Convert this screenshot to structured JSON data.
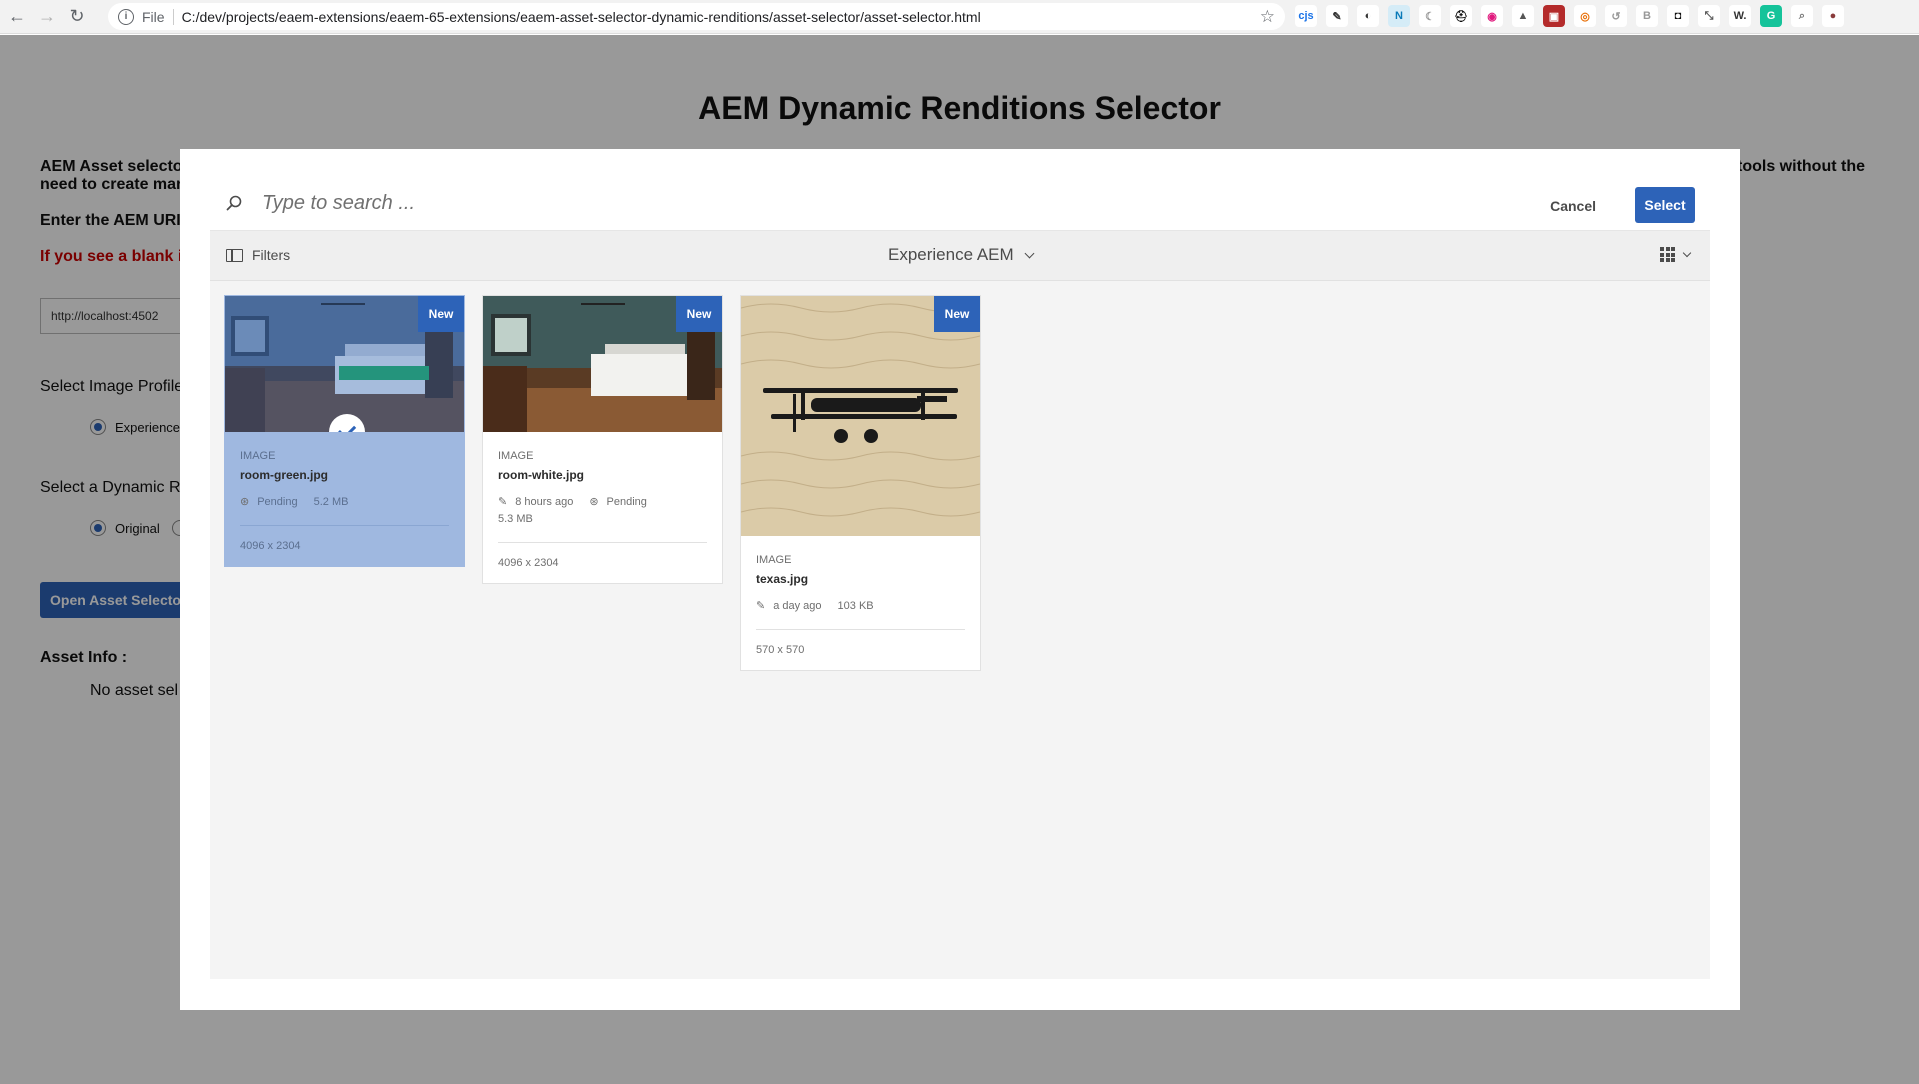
{
  "browser": {
    "url_scheme": "File",
    "url": "C:/dev/projects/eaem-extensions/eaem-65-extensions/eaem-asset-selector-dynamic-renditions/asset-selector/asset-selector.html",
    "extensions": [
      {
        "name": "cjs",
        "label": "cjs",
        "color": "#ffffff",
        "text": "#1a73e8"
      },
      {
        "name": "pen",
        "label": "✎",
        "color": "#ffffff",
        "text": "#333333"
      },
      {
        "name": "dark-reader",
        "label": "◐",
        "color": "#ffffff",
        "text": "#333333"
      },
      {
        "name": "n",
        "label": "N",
        "color": "#d5ecf7",
        "text": "#0a7ab8"
      },
      {
        "name": "moon",
        "label": "☾",
        "color": "#ffffff",
        "text": "#999999"
      },
      {
        "name": "spy",
        "label": "⛑",
        "color": "#ffffff",
        "text": "#111111"
      },
      {
        "name": "circle-pink",
        "label": "◉",
        "color": "#ffffff",
        "text": "#e0197d"
      },
      {
        "name": "drive",
        "label": "▲",
        "color": "#ffffff",
        "text": "#555555"
      },
      {
        "name": "red-box",
        "label": "▣",
        "color": "#b42b2b",
        "text": "#ffffff"
      },
      {
        "name": "target",
        "label": "◎",
        "color": "#ffffff",
        "text": "#e8710a"
      },
      {
        "name": "swirl",
        "label": "↺",
        "color": "#ffffff",
        "text": "#999999"
      },
      {
        "name": "b-box",
        "label": "B",
        "color": "#ffffff",
        "text": "#999999"
      },
      {
        "name": "ghost",
        "label": "◘",
        "color": "#ffffff",
        "text": "#111111"
      },
      {
        "name": "arrows",
        "label": "⤡",
        "color": "#ffffff",
        "text": "#555555"
      },
      {
        "name": "w",
        "label": "W.",
        "color": "#ffffff",
        "text": "#333333"
      },
      {
        "name": "g-green",
        "label": "G",
        "color": "#15c39a",
        "text": "#ffffff"
      },
      {
        "name": "search-ext",
        "label": "⌕",
        "color": "#ffffff",
        "text": "#777777"
      },
      {
        "name": "profile",
        "label": "●",
        "color": "#ffffff",
        "text": "#8a3b3b"
      }
    ]
  },
  "page": {
    "title": "AEM Dynamic Renditions Selector",
    "desc_left": "AEM Asset selecto\nneed to create mar",
    "desc_right": "tools without the",
    "url_label": "Enter the AEM URI",
    "warning": "If you see a blank i",
    "url_value": "http://localhost:4502",
    "image_profile_label": "Select Image Profile",
    "profile_option": "Experience",
    "rendition_label": "Select a Dynamic R",
    "rendition_option": "Original",
    "open_button": "Open Asset Selector",
    "asset_info_label": "Asset Info :",
    "no_asset": "No asset sel"
  },
  "dialog": {
    "search_placeholder": "Type to search ...",
    "cancel_label": "Cancel",
    "select_label": "Select",
    "filters_label": "Filters",
    "folder_label": "Experience AEM",
    "assets": [
      {
        "type": "IMAGE",
        "name": "room-green.jpg",
        "badge": "New",
        "selected": true,
        "info1": "Pending",
        "info2": "5.2 MB",
        "dimensions": "4096 x 2304"
      },
      {
        "type": "IMAGE",
        "name": "room-white.jpg",
        "badge": "New",
        "selected": false,
        "modified": "8 hours ago",
        "status": "Pending",
        "size": "5.3 MB",
        "dimensions": "4096 x 2304"
      },
      {
        "type": "IMAGE",
        "name": "texas.jpg",
        "badge": "New",
        "selected": false,
        "modified": "a day ago",
        "size": "103 KB",
        "dimensions": "570 x 570"
      }
    ]
  },
  "colors": {
    "accent": "#2d63b8",
    "selected_card": "#9fb8e0",
    "warning": "#cc0000"
  }
}
